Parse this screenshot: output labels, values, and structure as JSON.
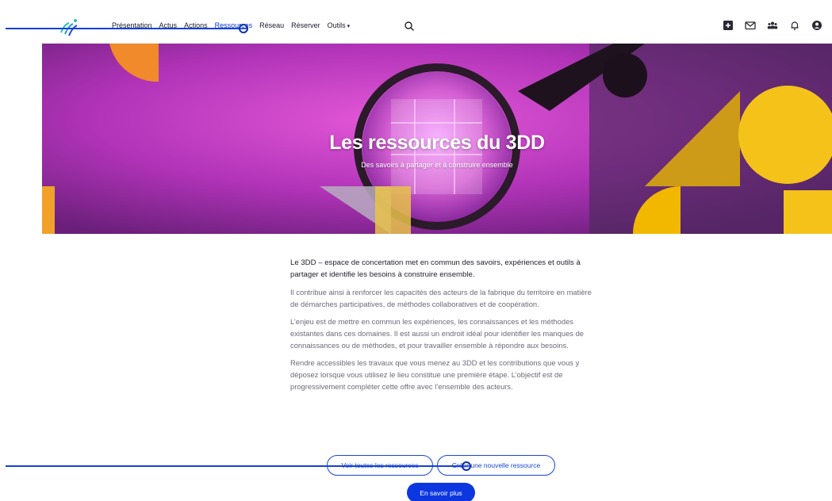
{
  "nav": {
    "links": [
      {
        "label": "Présentation"
      },
      {
        "label": "Actus"
      },
      {
        "label": "Actions"
      },
      {
        "label": "Ressources"
      },
      {
        "label": "Réseau"
      },
      {
        "label": "Réserver"
      },
      {
        "label": "Outils"
      }
    ],
    "active_index": 3,
    "tools_caret": "▾"
  },
  "icons": {
    "logo": "3dd-logo",
    "search": "search-icon",
    "right": [
      "add-square-icon",
      "mail-icon",
      "group-icon",
      "bell-icon",
      "account-icon"
    ]
  },
  "hero": {
    "title": "Les ressources du 3DD",
    "subtitle": "Des savoirs à partager et à construire ensemble"
  },
  "content": {
    "lead": "Le 3DD – espace de concertation met en commun des savoirs, expériences et outils à partager et identifie les besoins à construire ensemble.",
    "paragraphs": [
      "Il contribue ainsi à renforcer les capacités des acteurs de la fabrique du territoire en matière de démarches participatives, de méthodes collaboratives et de coopération.",
      "L’enjeu est de mettre en commun les expériences, les connaissances et les méthodes existantes dans ces domaines. Il est aussi un endroit idéal pour identifier les manques de connaissances ou de méthodes, et pour travailler ensemble à répondre aux besoins.",
      "Rendre accessibles les travaux que vous menez au 3DD et les contributions que vous y déposez lorsque vous utilisez le lieu constitue une première étape. L’objectif est de progressivement compléter cette offre avec l’ensemble des acteurs."
    ]
  },
  "buttons": {
    "all_resources": "Voir toutes les ressources",
    "create_resource": "Créer une nouvelle ressource",
    "learn_more": "En savoir plus"
  },
  "colors": {
    "accent": "#0c37e0",
    "hero_magenta": "#c43fc1",
    "hero_yellow": "#f5b800",
    "hero_orange": "#e8822a"
  }
}
